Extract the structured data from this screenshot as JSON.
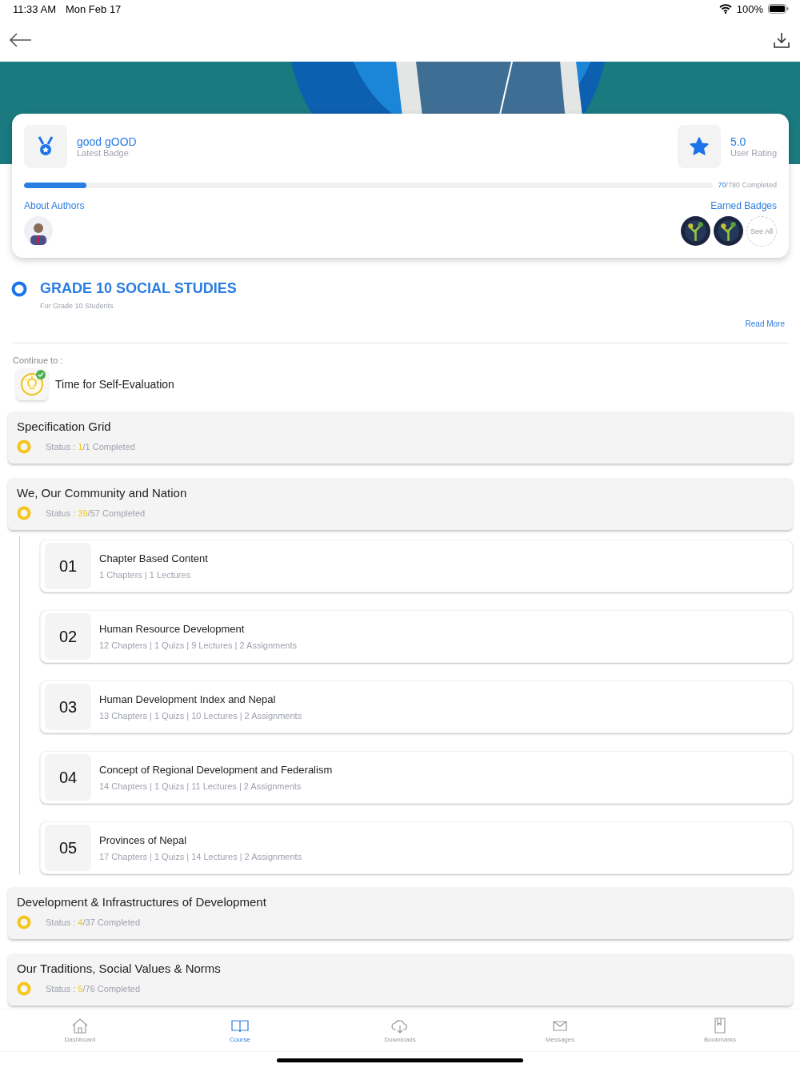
{
  "status_bar": {
    "time": "11:33 AM",
    "date": "Mon Feb 17",
    "battery": "100%"
  },
  "banner": {
    "kind": "picture"
  },
  "summary": {
    "badge_name": "good gOOD",
    "badge_label": "Latest Badge",
    "rating": "5.0",
    "rating_label": "User Rating",
    "level": 0.09,
    "progress_done": "70",
    "progress_rest": "/780 Completed",
    "authors_label": "About Authors",
    "authors": [
      {
        "kind": "picture"
      }
    ],
    "badges_label": "Earned Badges",
    "badges": [
      {
        "kind": "picture"
      },
      {
        "kind": "picture"
      }
    ],
    "see_all": "See All"
  },
  "course": {
    "title": "GRADE 10 SOCIAL STUDIES",
    "subtitle": "For Grade 10 Students",
    "read_more": "Read More"
  },
  "continue": {
    "label": "Continue to :",
    "item": "Time for Self-Evaluation",
    "done": true
  },
  "sections": [
    {
      "title": "Specification Grid",
      "status_label": "Status :",
      "done": "1",
      "rest": "/1 Completed"
    },
    {
      "title": "We, Our Community and Nation",
      "status_label": "Status :",
      "done": "39",
      "rest": "/57 Completed",
      "chapters": [
        {
          "number": "01",
          "title": "Chapter Based Content",
          "meta": "1 Chapters | 1 Lectures"
        },
        {
          "number": "02",
          "title": "Human Resource Development",
          "meta": "12 Chapters | 1 Quizs | 9 Lectures | 2 Assignments"
        },
        {
          "number": "03",
          "title": "Human Development Index and Nepal",
          "meta": "13 Chapters | 1 Quizs | 10 Lectures | 2 Assignments"
        },
        {
          "number": "04",
          "title": "Concept of Regional Development and Federalism",
          "meta": "14 Chapters | 1 Quizs | 11 Lectures | 2 Assignments"
        },
        {
          "number": "05",
          "title": "Provinces of Nepal",
          "meta": "17 Chapters | 1 Quizs | 14 Lectures | 2 Assignments"
        }
      ]
    },
    {
      "title": "Development & Infrastructures of Development",
      "status_label": "Status :",
      "done": "4",
      "rest": "/37 Completed"
    },
    {
      "title": "Our Traditions, Social Values & Norms",
      "status_label": "Status :",
      "done": "5",
      "rest": "/76 Completed"
    }
  ],
  "tab_bar": [
    {
      "kind": "home",
      "label": "Dashboard",
      "selected": false
    },
    {
      "kind": "book",
      "label": "Course",
      "selected": true
    },
    {
      "kind": "cloud",
      "label": "Downloads",
      "selected": false
    },
    {
      "kind": "mail",
      "label": "Messages",
      "selected": false
    },
    {
      "kind": "bookmark",
      "label": "Bookmarks",
      "selected": false
    }
  ]
}
